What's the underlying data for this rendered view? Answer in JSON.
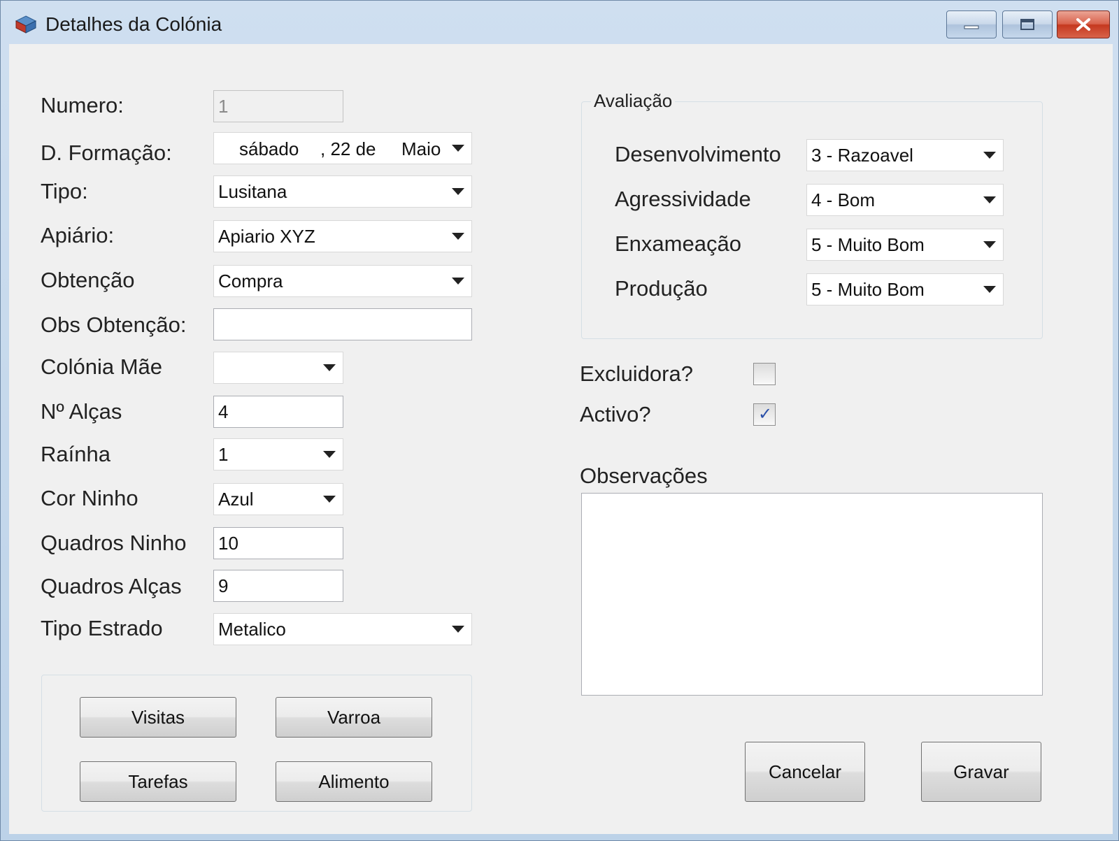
{
  "window": {
    "title": "Detalhes da Colónia"
  },
  "form": {
    "numero": {
      "label": "Numero:",
      "value": "1"
    },
    "data_formacao": {
      "label": "D. Formação:",
      "weekday": "sábado",
      "day": ", 22 de",
      "month": "Maio"
    },
    "tipo": {
      "label": "Tipo:",
      "value": "Lusitana"
    },
    "apiario": {
      "label": "Apiário:",
      "value": "Apiario XYZ"
    },
    "obtencao": {
      "label": "Obtenção",
      "value": "Compra"
    },
    "obs_obtencao": {
      "label": "Obs Obtenção:",
      "value": ""
    },
    "colonia_mae": {
      "label": "Colónia Mãe",
      "value": ""
    },
    "n_alcas": {
      "label": "Nº Alças",
      "value": "4"
    },
    "rainha": {
      "label": "Raínha",
      "value": "1"
    },
    "cor_ninho": {
      "label": "Cor Ninho",
      "value": "Azul"
    },
    "quadros_ninho": {
      "label": "Quadros Ninho",
      "value": "10"
    },
    "quadros_alcas": {
      "label": "Quadros Alças",
      "value": "9"
    },
    "tipo_estrado": {
      "label": "Tipo Estrado",
      "value": "Metalico"
    }
  },
  "actions": {
    "visitas": "Visitas",
    "varroa": "Varroa",
    "tarefas": "Tarefas",
    "alimento": "Alimento"
  },
  "avaliacao": {
    "title": "Avaliação",
    "desenvolvimento": {
      "label": "Desenvolvimento",
      "value": "3 - Razoavel"
    },
    "agressividade": {
      "label": "Agressividade",
      "value": "4 - Bom"
    },
    "enxameacao": {
      "label": "Enxameação",
      "value": "5 - Muito Bom"
    },
    "producao": {
      "label": "Produção",
      "value": "5 - Muito Bom"
    }
  },
  "flags": {
    "excluidora": {
      "label": "Excluidora?",
      "checked": false
    },
    "activo": {
      "label": "Activo?",
      "checked": true,
      "mark": "✓"
    }
  },
  "observacoes": {
    "label": "Observações",
    "value": ""
  },
  "footer": {
    "cancel": "Cancelar",
    "save": "Gravar"
  }
}
